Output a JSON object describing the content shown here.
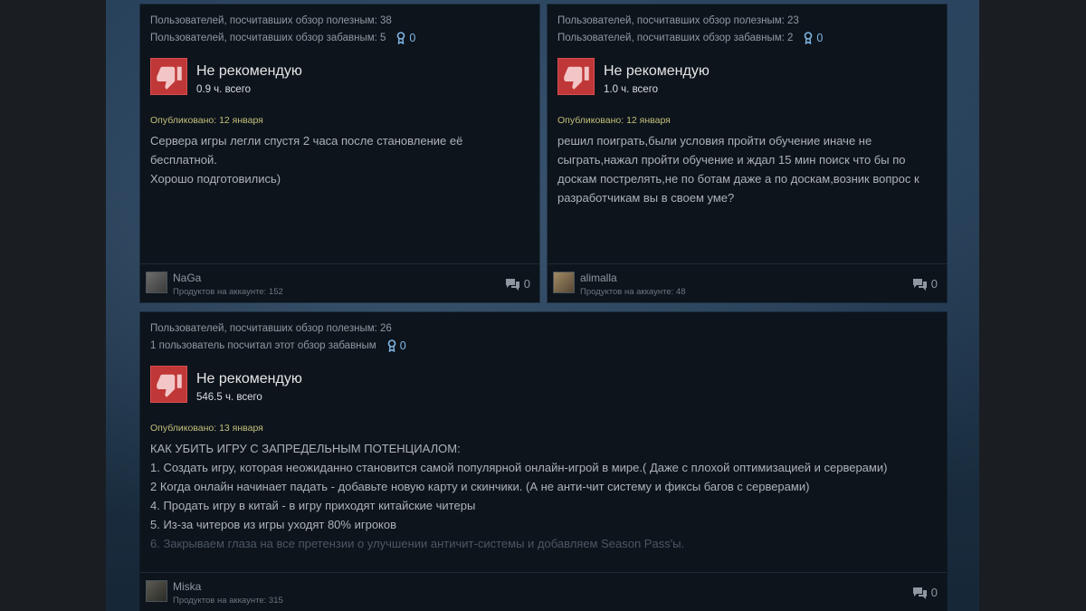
{
  "reviews": [
    {
      "helpful": "Пользователей, посчитавших обзор полезным: 38",
      "funny": "Пользователей, посчитавших обзор забавным: 5",
      "awards": "0",
      "verdict": "Не рекомендую",
      "hours": "0.9 ч. всего",
      "posted": "Опубликовано: 12 января",
      "text": [
        "Сервера игры легли спустя 2 часа после становление её",
        "бесплатной.",
        "Хорошо подготовились)"
      ],
      "user": "NaGa",
      "products": "Продуктов на аккаунте: 152",
      "comments": "0"
    },
    {
      "helpful": "Пользователей, посчитавших обзор полезным: 23",
      "funny": "Пользователей, посчитавших обзор забавным: 2",
      "awards": "0",
      "verdict": "Не рекомендую",
      "hours": "1.0 ч. всего",
      "posted": "Опубликовано: 12 января",
      "text": [
        "решил поиграть,были условия пройти обучение иначе не",
        "сыграть,нажал пройти обучение и ждал 15 мин поиск что бы по",
        "доскам пострелять,не по ботам даже а по доскам,возник вопрос к",
        "разработчикам вы в своем уме?"
      ],
      "user": "alimalla",
      "products": "Продуктов на аккаунте: 48",
      "comments": "0"
    },
    {
      "helpful": "Пользователей, посчитавших обзор полезным: 26",
      "funny": "1 пользователь посчитал этот обзор забавным",
      "awards": "0",
      "verdict": "Не рекомендую",
      "hours": "546.5 ч. всего",
      "posted": "Опубликовано: 13 января",
      "text": [
        "КАК УБИТЬ ИГРУ С ЗАПРЕДЕЛЬНЫМ ПОТЕНЦИАЛОМ:",
        "1. Создать игру, которая неожиданно становится самой популярной онлайн-игрой в мире.( Даже с плохой оптимизацией и серверами)",
        "2 Когда онлайн начинает падать - добавьте новую карту и скинчики. (А не анти-чит систему и фиксы багов с серверами)",
        "4. Продать игру в китай - в игру приходят китайские читеры",
        "5. Из-за читеров из игры уходят 80% игроков",
        "6. Закрываем глаза на все претензии о улучшении античит-системы и добавляем Season Pass'ы."
      ],
      "user": "Miska",
      "products": "Продуктов на аккаунте: 315",
      "comments": "0"
    }
  ],
  "icons": {
    "thumb": "thumbs-down-icon",
    "award": "award-icon",
    "comments": "comment-icon"
  },
  "colors": {
    "not_recommended": "#c03737",
    "award": "#7fb7e6",
    "posted": "#c3bf7a"
  }
}
